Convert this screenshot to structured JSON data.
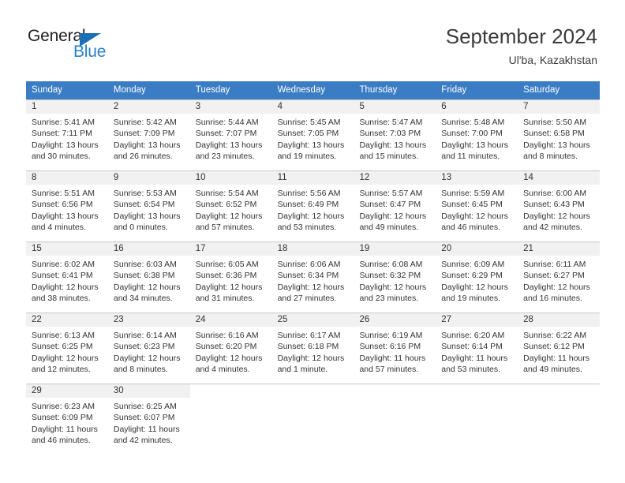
{
  "brand": {
    "name_dark": "General",
    "name_blue": "Blue",
    "triangle_color": "#1c6fb5",
    "blue_color": "#2980c9"
  },
  "header": {
    "title": "September 2024",
    "subtitle": "Ul'ba, Kazakhstan",
    "accent_color": "#3b7dc4"
  },
  "labels": {
    "sunrise_prefix": "Sunrise:",
    "sunset_prefix": "Sunset:",
    "daylight_prefix": "Daylight:"
  },
  "weekdays": [
    "Sunday",
    "Monday",
    "Tuesday",
    "Wednesday",
    "Thursday",
    "Friday",
    "Saturday"
  ],
  "weeks": [
    [
      {
        "day": "1",
        "sunrise": "Sunrise: 5:41 AM",
        "sunset": "Sunset: 7:11 PM",
        "daylight1": "Daylight: 13 hours",
        "daylight2": "and 30 minutes."
      },
      {
        "day": "2",
        "sunrise": "Sunrise: 5:42 AM",
        "sunset": "Sunset: 7:09 PM",
        "daylight1": "Daylight: 13 hours",
        "daylight2": "and 26 minutes."
      },
      {
        "day": "3",
        "sunrise": "Sunrise: 5:44 AM",
        "sunset": "Sunset: 7:07 PM",
        "daylight1": "Daylight: 13 hours",
        "daylight2": "and 23 minutes."
      },
      {
        "day": "4",
        "sunrise": "Sunrise: 5:45 AM",
        "sunset": "Sunset: 7:05 PM",
        "daylight1": "Daylight: 13 hours",
        "daylight2": "and 19 minutes."
      },
      {
        "day": "5",
        "sunrise": "Sunrise: 5:47 AM",
        "sunset": "Sunset: 7:03 PM",
        "daylight1": "Daylight: 13 hours",
        "daylight2": "and 15 minutes."
      },
      {
        "day": "6",
        "sunrise": "Sunrise: 5:48 AM",
        "sunset": "Sunset: 7:00 PM",
        "daylight1": "Daylight: 13 hours",
        "daylight2": "and 11 minutes."
      },
      {
        "day": "7",
        "sunrise": "Sunrise: 5:50 AM",
        "sunset": "Sunset: 6:58 PM",
        "daylight1": "Daylight: 13 hours",
        "daylight2": "and 8 minutes."
      }
    ],
    [
      {
        "day": "8",
        "sunrise": "Sunrise: 5:51 AM",
        "sunset": "Sunset: 6:56 PM",
        "daylight1": "Daylight: 13 hours",
        "daylight2": "and 4 minutes."
      },
      {
        "day": "9",
        "sunrise": "Sunrise: 5:53 AM",
        "sunset": "Sunset: 6:54 PM",
        "daylight1": "Daylight: 13 hours",
        "daylight2": "and 0 minutes."
      },
      {
        "day": "10",
        "sunrise": "Sunrise: 5:54 AM",
        "sunset": "Sunset: 6:52 PM",
        "daylight1": "Daylight: 12 hours",
        "daylight2": "and 57 minutes."
      },
      {
        "day": "11",
        "sunrise": "Sunrise: 5:56 AM",
        "sunset": "Sunset: 6:49 PM",
        "daylight1": "Daylight: 12 hours",
        "daylight2": "and 53 minutes."
      },
      {
        "day": "12",
        "sunrise": "Sunrise: 5:57 AM",
        "sunset": "Sunset: 6:47 PM",
        "daylight1": "Daylight: 12 hours",
        "daylight2": "and 49 minutes."
      },
      {
        "day": "13",
        "sunrise": "Sunrise: 5:59 AM",
        "sunset": "Sunset: 6:45 PM",
        "daylight1": "Daylight: 12 hours",
        "daylight2": "and 46 minutes."
      },
      {
        "day": "14",
        "sunrise": "Sunrise: 6:00 AM",
        "sunset": "Sunset: 6:43 PM",
        "daylight1": "Daylight: 12 hours",
        "daylight2": "and 42 minutes."
      }
    ],
    [
      {
        "day": "15",
        "sunrise": "Sunrise: 6:02 AM",
        "sunset": "Sunset: 6:41 PM",
        "daylight1": "Daylight: 12 hours",
        "daylight2": "and 38 minutes."
      },
      {
        "day": "16",
        "sunrise": "Sunrise: 6:03 AM",
        "sunset": "Sunset: 6:38 PM",
        "daylight1": "Daylight: 12 hours",
        "daylight2": "and 34 minutes."
      },
      {
        "day": "17",
        "sunrise": "Sunrise: 6:05 AM",
        "sunset": "Sunset: 6:36 PM",
        "daylight1": "Daylight: 12 hours",
        "daylight2": "and 31 minutes."
      },
      {
        "day": "18",
        "sunrise": "Sunrise: 6:06 AM",
        "sunset": "Sunset: 6:34 PM",
        "daylight1": "Daylight: 12 hours",
        "daylight2": "and 27 minutes."
      },
      {
        "day": "19",
        "sunrise": "Sunrise: 6:08 AM",
        "sunset": "Sunset: 6:32 PM",
        "daylight1": "Daylight: 12 hours",
        "daylight2": "and 23 minutes."
      },
      {
        "day": "20",
        "sunrise": "Sunrise: 6:09 AM",
        "sunset": "Sunset: 6:29 PM",
        "daylight1": "Daylight: 12 hours",
        "daylight2": "and 19 minutes."
      },
      {
        "day": "21",
        "sunrise": "Sunrise: 6:11 AM",
        "sunset": "Sunset: 6:27 PM",
        "daylight1": "Daylight: 12 hours",
        "daylight2": "and 16 minutes."
      }
    ],
    [
      {
        "day": "22",
        "sunrise": "Sunrise: 6:13 AM",
        "sunset": "Sunset: 6:25 PM",
        "daylight1": "Daylight: 12 hours",
        "daylight2": "and 12 minutes."
      },
      {
        "day": "23",
        "sunrise": "Sunrise: 6:14 AM",
        "sunset": "Sunset: 6:23 PM",
        "daylight1": "Daylight: 12 hours",
        "daylight2": "and 8 minutes."
      },
      {
        "day": "24",
        "sunrise": "Sunrise: 6:16 AM",
        "sunset": "Sunset: 6:20 PM",
        "daylight1": "Daylight: 12 hours",
        "daylight2": "and 4 minutes."
      },
      {
        "day": "25",
        "sunrise": "Sunrise: 6:17 AM",
        "sunset": "Sunset: 6:18 PM",
        "daylight1": "Daylight: 12 hours",
        "daylight2": "and 1 minute."
      },
      {
        "day": "26",
        "sunrise": "Sunrise: 6:19 AM",
        "sunset": "Sunset: 6:16 PM",
        "daylight1": "Daylight: 11 hours",
        "daylight2": "and 57 minutes."
      },
      {
        "day": "27",
        "sunrise": "Sunrise: 6:20 AM",
        "sunset": "Sunset: 6:14 PM",
        "daylight1": "Daylight: 11 hours",
        "daylight2": "and 53 minutes."
      },
      {
        "day": "28",
        "sunrise": "Sunrise: 6:22 AM",
        "sunset": "Sunset: 6:12 PM",
        "daylight1": "Daylight: 11 hours",
        "daylight2": "and 49 minutes."
      }
    ],
    [
      {
        "day": "29",
        "sunrise": "Sunrise: 6:23 AM",
        "sunset": "Sunset: 6:09 PM",
        "daylight1": "Daylight: 11 hours",
        "daylight2": "and 46 minutes."
      },
      {
        "day": "30",
        "sunrise": "Sunrise: 6:25 AM",
        "sunset": "Sunset: 6:07 PM",
        "daylight1": "Daylight: 11 hours",
        "daylight2": "and 42 minutes."
      },
      {
        "day": "",
        "sunrise": "",
        "sunset": "",
        "daylight1": "",
        "daylight2": ""
      },
      {
        "day": "",
        "sunrise": "",
        "sunset": "",
        "daylight1": "",
        "daylight2": ""
      },
      {
        "day": "",
        "sunrise": "",
        "sunset": "",
        "daylight1": "",
        "daylight2": ""
      },
      {
        "day": "",
        "sunrise": "",
        "sunset": "",
        "daylight1": "",
        "daylight2": ""
      },
      {
        "day": "",
        "sunrise": "",
        "sunset": "",
        "daylight1": "",
        "daylight2": ""
      }
    ]
  ]
}
